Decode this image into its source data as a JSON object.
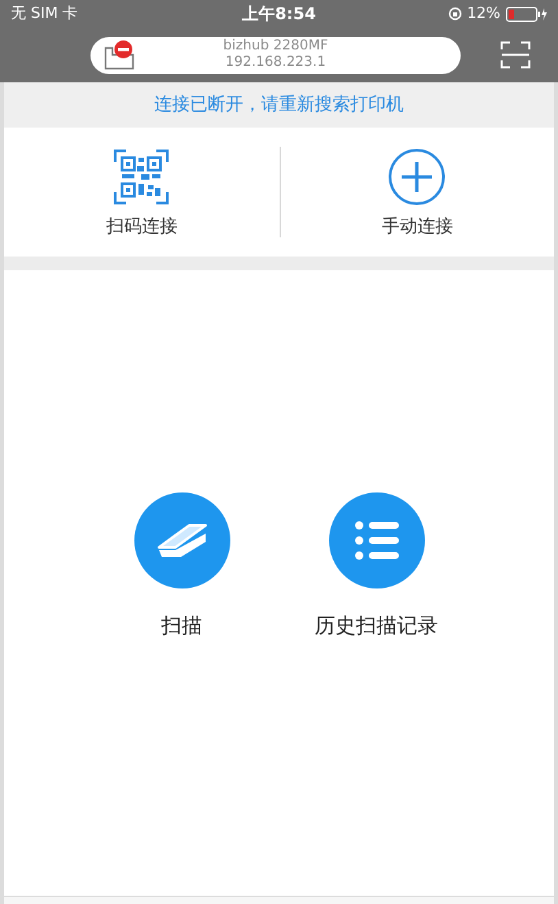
{
  "status_bar": {
    "carrier": "无 SIM 卡",
    "time": "上午8:54",
    "battery": "12%"
  },
  "printer": {
    "name": "bizhub 2280MF",
    "address": "192.168.223.1",
    "connected": false
  },
  "banner": "连接已断开，请重新搜索打印机",
  "connect_options": [
    {
      "kind": "qr",
      "label": "扫码连接"
    },
    {
      "kind": "manual",
      "label": "手动连接"
    }
  ],
  "actions": [
    {
      "kind": "scan",
      "label": "扫描"
    },
    {
      "kind": "history",
      "label": "历史扫描记录"
    }
  ]
}
